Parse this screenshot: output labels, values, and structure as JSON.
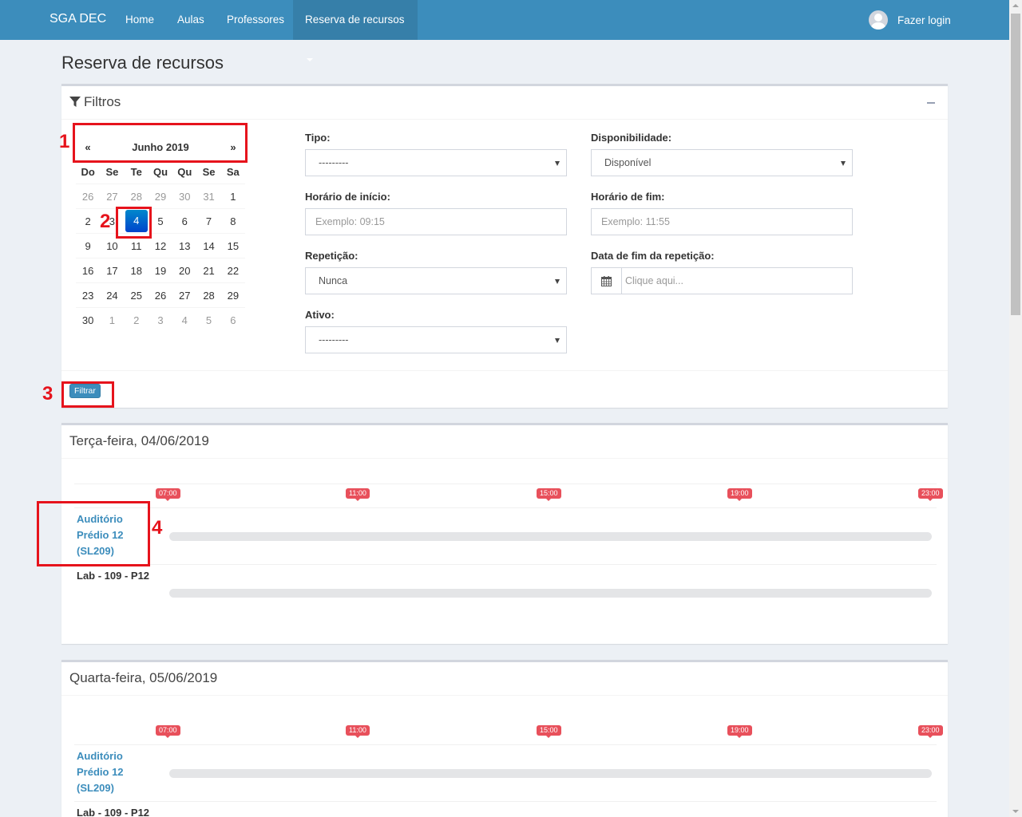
{
  "navbar": {
    "brand": "SGA DEC",
    "items": [
      {
        "label": "Home"
      },
      {
        "label": "Aulas"
      },
      {
        "label": "Professores"
      },
      {
        "label": "Reserva de recursos"
      }
    ],
    "login_label": "Fazer login",
    "color": "#3c8dbc"
  },
  "page": {
    "title": "Reserva de recursos"
  },
  "filters": {
    "title": "Filtros",
    "calendar": {
      "prev": "«",
      "next": "»",
      "month": "Junho 2019",
      "weekdays": [
        "Do",
        "Se",
        "Te",
        "Qu",
        "Qu",
        "Se",
        "Sa"
      ],
      "weeks": [
        [
          "26",
          "27",
          "28",
          "29",
          "30",
          "31",
          "1"
        ],
        [
          "2",
          "3",
          "4",
          "5",
          "6",
          "7",
          "8"
        ],
        [
          "9",
          "10",
          "11",
          "12",
          "13",
          "14",
          "15"
        ],
        [
          "16",
          "17",
          "18",
          "19",
          "20",
          "21",
          "22"
        ],
        [
          "23",
          "24",
          "25",
          "26",
          "27",
          "28",
          "29"
        ],
        [
          "30",
          "1",
          "2",
          "3",
          "4",
          "5",
          "6"
        ]
      ],
      "selected": "4"
    },
    "tipo": {
      "label": "Tipo:",
      "value": "---------"
    },
    "disponibilidade": {
      "label": "Disponibilidade:",
      "value": "Disponível"
    },
    "horario_inicio": {
      "label": "Horário de início:",
      "placeholder": "Exemplo: 09:15"
    },
    "horario_fim": {
      "label": "Horário de fim:",
      "placeholder": "Exemplo: 11:55"
    },
    "repeticao": {
      "label": "Repetição:",
      "value": "Nunca"
    },
    "data_fim": {
      "label": "Data de fim da repetição:",
      "placeholder": "Clique aqui..."
    },
    "ativo": {
      "label": "Ativo:",
      "value": "---------"
    },
    "submit_label": "Filtrar"
  },
  "days": [
    {
      "title": "Terça-feira, 04/06/2019",
      "hours": [
        "07:00",
        "11:00",
        "15:00",
        "19:00",
        "23:00"
      ],
      "resources": [
        {
          "name_lines": [
            "Auditório",
            "Prédio 12",
            "(SL209)"
          ]
        },
        {
          "name_lines": [
            "Lab - 109 - P12"
          ]
        }
      ]
    },
    {
      "title": "Quarta-feira, 05/06/2019",
      "hours": [
        "07:00",
        "11:00",
        "15:00",
        "19:00",
        "23:00"
      ],
      "resources": [
        {
          "name_lines": [
            "Auditório",
            "Prédio 12",
            "(SL209)"
          ]
        },
        {
          "name_lines": [
            "Lab - 109 - P12"
          ]
        }
      ]
    }
  ],
  "annotations": [
    "1",
    "2",
    "3",
    "4"
  ]
}
